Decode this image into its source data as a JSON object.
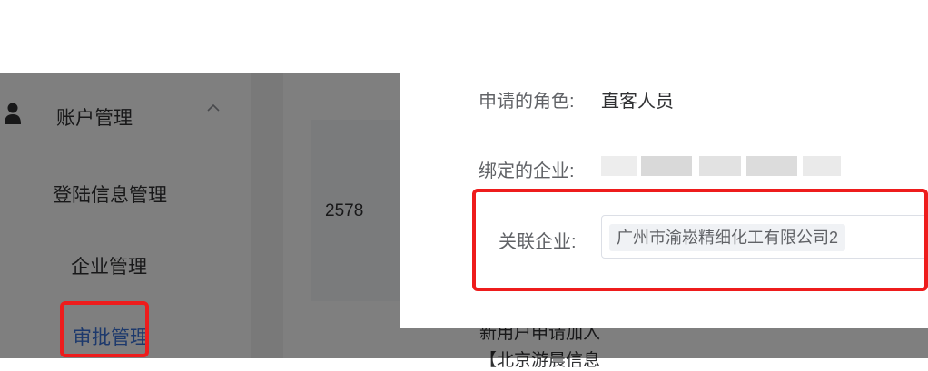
{
  "sidebar": {
    "group_label": "账户管理",
    "items": [
      {
        "label": "登陆信息管理"
      },
      {
        "label": "企业管理"
      },
      {
        "label": "审批管理"
      }
    ]
  },
  "main": {
    "row_number": "2578",
    "bottom_lines": [
      "新用户申请加入",
      "【北京游晨信息"
    ]
  },
  "modal": {
    "role_label": "申请的角色:",
    "role_value": "直客人员",
    "bound_company_label": "绑定的企业:",
    "linked_company_label": "关联企业:",
    "linked_company_tag": "广州市渝崧精细化工有限公司2"
  },
  "colors": {
    "highlight_red": "#ee1c1c",
    "active_menu": "#3b73d9"
  },
  "icons": [
    "user-icon",
    "chevron-up-icon"
  ]
}
